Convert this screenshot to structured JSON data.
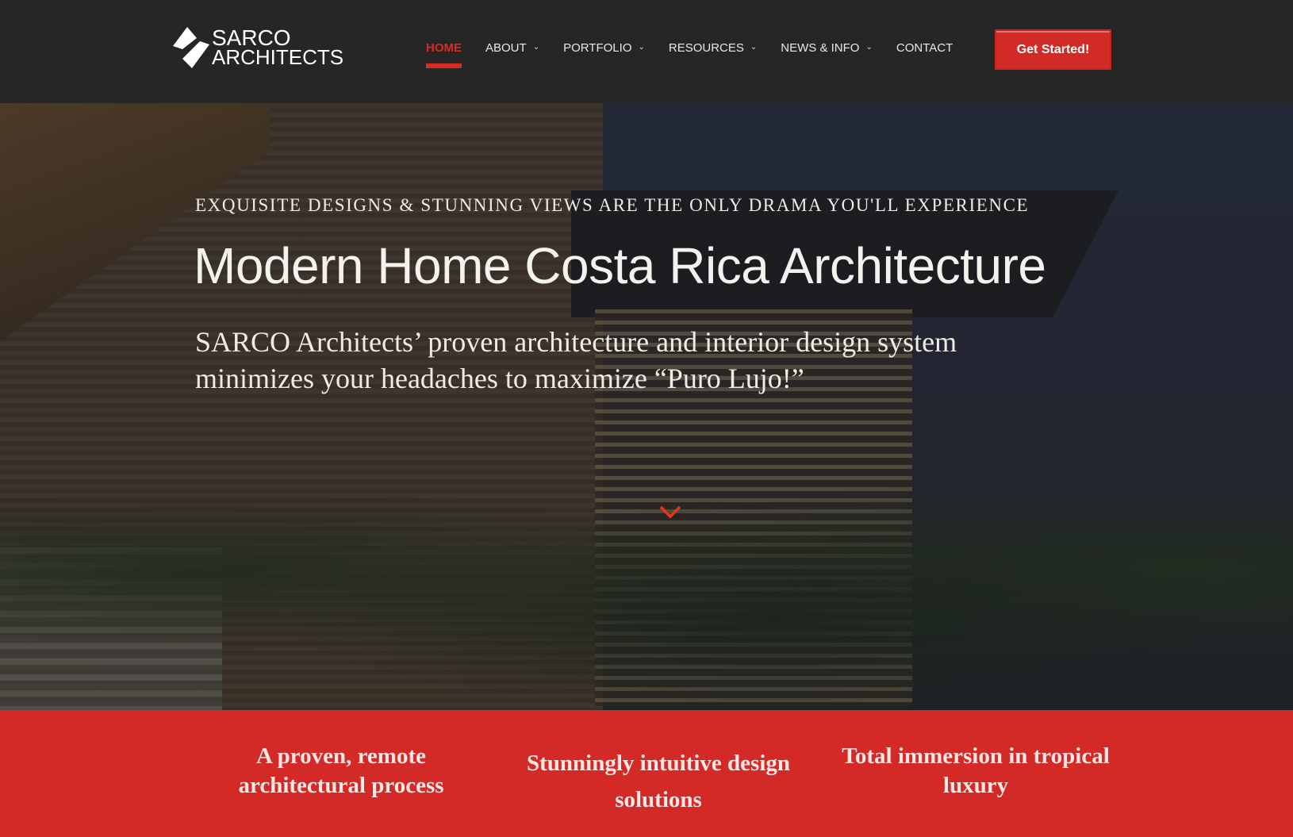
{
  "brand": {
    "line1": "SARCO",
    "line2": "ARCHITECTS"
  },
  "nav": [
    {
      "label": "HOME",
      "active": true,
      "dropdown": false
    },
    {
      "label": "ABOUT",
      "dropdown": true
    },
    {
      "label": "PORTFOLIO",
      "dropdown": true
    },
    {
      "label": "RESOURCES",
      "dropdown": true
    },
    {
      "label": "NEWS & INFO",
      "dropdown": true
    },
    {
      "label": "CONTACT",
      "dropdown": false
    }
  ],
  "cta": "Get Started!",
  "hero": {
    "kicker": "EXQUISITE DESIGNS & STUNNING VIEWS ARE THE ONLY DRAMA YOU'LL EXPERIENCE",
    "title": "Modern Home Costa Rica Architecture",
    "lede": "SARCO Architects’ proven architecture and interior design system minimizes your headaches to maximize “Puro Lujo!”",
    "scroll_icon": "chevron-down-icon"
  },
  "features": [
    "A proven, remote architectural process",
    "Stunningly intuitive design solutions",
    "Total immersion in tropical luxury"
  ],
  "colors": {
    "accent": "#d42a27",
    "header": "#262626"
  }
}
